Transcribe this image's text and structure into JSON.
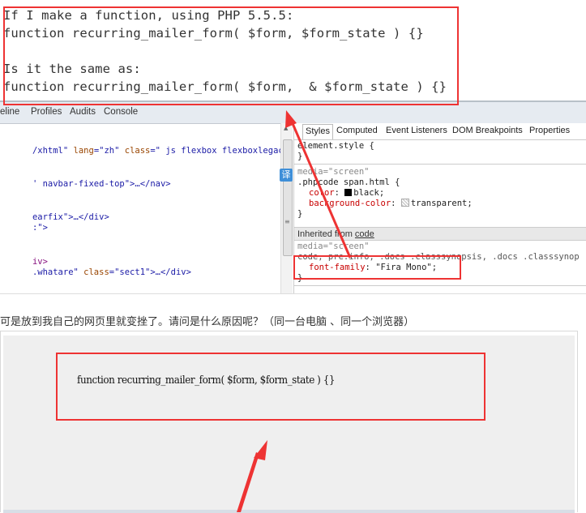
{
  "top_snippet": {
    "lines": [
      "If I make a function, using PHP 5.5.5:",
      "function recurring_mailer_form( $form, $form_state ) {}",
      "Is it the same as:",
      "function recurring_mailer_form( $form,  & $form_state ) {}"
    ]
  },
  "devtools": {
    "panel_tabs": [
      "eline",
      "Profiles",
      "Audits",
      "Console"
    ],
    "elements": {
      "lines": [
        {
          "a": "/xhtml\" ",
          "b": "lang",
          "c": "=\"zh\" ",
          "d": "class",
          "e": "=\" js flexbox flexboxlegacy da"
        },
        {
          "a": "' navbar-fixed-top\">…</nav>"
        },
        {
          "a": "earfix\">…</div>"
        },
        {
          "a": ":\">"
        },
        {
          "a": "iv>"
        },
        {
          "a": ".whatare\" ",
          "d": "class",
          "e": "=\"sect1\">…</div>"
        }
      ]
    },
    "translate_icon_glyph": "译",
    "styles": {
      "tabs": [
        "Styles",
        "Computed",
        "Event Listeners",
        "DOM Breakpoints",
        "Properties"
      ],
      "active_tab": "Styles",
      "element_style": "element.style {",
      "close_brace": "}",
      "media_screen": "media=\"screen\"",
      "rule1_selector": ".phpcode span.html {",
      "rule1_prop1_name": "color",
      "rule1_prop1_value": "black;",
      "rule1_prop2_name": "background-color",
      "rule1_prop2_value": "transparent;",
      "inherited_label": "Inherited from ",
      "inherited_link": "code",
      "rule2_selector": "code, pre.info, .docs .classsynopsis, .docs .classsynop",
      "rule2_prop_name": "font-family",
      "rule2_prop_value": "\"Fira Mono\";"
    }
  },
  "question": "可是放到我自己的网页里就变挫了。请问是什么原因呢？（同一台电脑 、同一个浏览器）",
  "rendered_code": "function recurring_mailer_form( $form, $form_state ) {}",
  "annotation_color": "#ee3333"
}
